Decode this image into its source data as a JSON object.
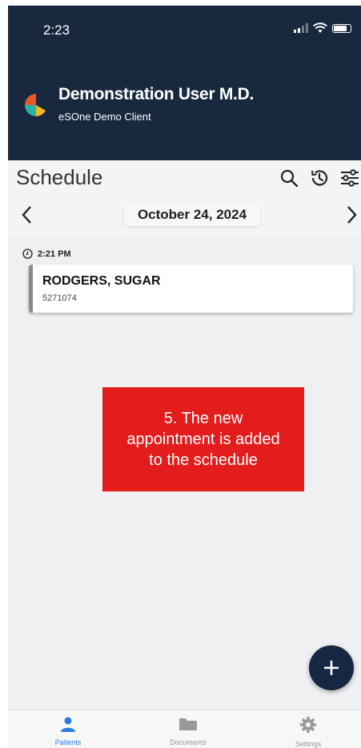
{
  "status_bar": {
    "time": "2:23"
  },
  "header": {
    "user_name": "Demonstration User M.D.",
    "client_name": "eSOne Demo Client"
  },
  "schedule": {
    "title": "Schedule",
    "date": "October 24, 2024",
    "icons": [
      "search-icon",
      "history-icon",
      "filter-icon"
    ]
  },
  "appointments": [
    {
      "time": "2:21 PM",
      "patient_name": "RODGERS, SUGAR",
      "patient_id": "5271074"
    }
  ],
  "annotation": {
    "text": "5. The new appointment is added to the schedule"
  },
  "bottom_nav": {
    "items": [
      {
        "label": "Patients",
        "icon": "person-icon",
        "active": true
      },
      {
        "label": "Documents",
        "icon": "folder-icon",
        "active": false
      },
      {
        "label": "Settings",
        "icon": "gear-icon",
        "active": false
      }
    ]
  },
  "colors": {
    "header_bg": "#17283f",
    "annotation_bg": "#e31c1c",
    "fab_bg": "#152742",
    "active_nav": "#2a7de1"
  }
}
